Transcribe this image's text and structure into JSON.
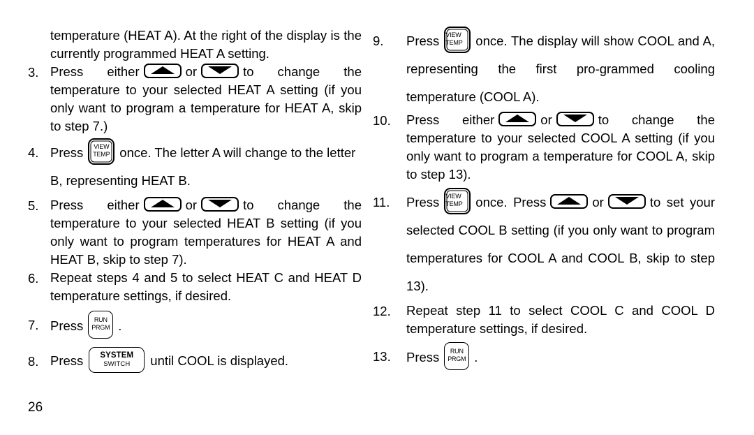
{
  "document": {
    "page_number": "26",
    "keys": {
      "up_arrow": {
        "name": "up-arrow-key",
        "label": ""
      },
      "down_arrow": {
        "name": "down-arrow-key",
        "label": ""
      },
      "view_temp": {
        "line1": "VIEW",
        "line2": "TEMP"
      },
      "run_prgm": {
        "line1": "RUN",
        "line2": "PRGM"
      },
      "system_switch": {
        "line1": "SYSTEM",
        "line2": "SWITCH"
      }
    }
  },
  "left_column": {
    "intro": {
      "text": "temperature (HEAT A).  At the right of the display is the currently programmed HEAT A setting."
    },
    "steps": [
      {
        "number": "3.",
        "parts": {
          "p1": "Press either",
          "p2": "or",
          "p3": "to change the temperature to your selected HEAT A setting (if you only want to program a temperature for HEAT A, skip to step 7.)"
        }
      },
      {
        "number": "4.",
        "parts": {
          "p1": "Press",
          "p2": "once.  The letter A will change to the letter B, representing HEAT B."
        }
      },
      {
        "number": "5.",
        "parts": {
          "p1": "Press either",
          "p2": "or",
          "p3": "to change the temperature to your selected HEAT B setting (if you only want to program temperatures for HEAT A and HEAT B, skip to step 7)."
        }
      },
      {
        "number": "6.",
        "parts": {
          "p1": "Repeat steps 4 and 5 to select HEAT C and HEAT D temperature settings, if desired."
        }
      },
      {
        "number": "7.",
        "parts": {
          "p1": "Press",
          "p2": "."
        }
      },
      {
        "number": "8.",
        "parts": {
          "p1": "Press",
          "p2": "until COOL is displayed."
        }
      }
    ]
  },
  "right_column": {
    "steps": [
      {
        "number": "9.",
        "parts": {
          "p1": "Press",
          "p2": "once.  The display will show COOL and A, representing the first pro-grammed cooling temperature (COOL A)."
        }
      },
      {
        "number": "10.",
        "parts": {
          "p1": "Press either",
          "p2": "or",
          "p3": "to change the temperature to your selected COOL A setting (if you only want to program a temperature for COOL A, skip to step 13)."
        }
      },
      {
        "number": "11.",
        "parts": {
          "p1": "Press",
          "p2": "once. Press",
          "p3": "or",
          "p4": "to set your selected COOL B setting (if you only want to program temperatures for COOL A and COOL B, skip to step 13)."
        }
      },
      {
        "number": "12.",
        "parts": {
          "p1": "Repeat step 11 to select COOL C and COOL D temperature settings, if desired."
        }
      },
      {
        "number": "13.",
        "parts": {
          "p1": "Press",
          "p2": "."
        }
      }
    ]
  }
}
